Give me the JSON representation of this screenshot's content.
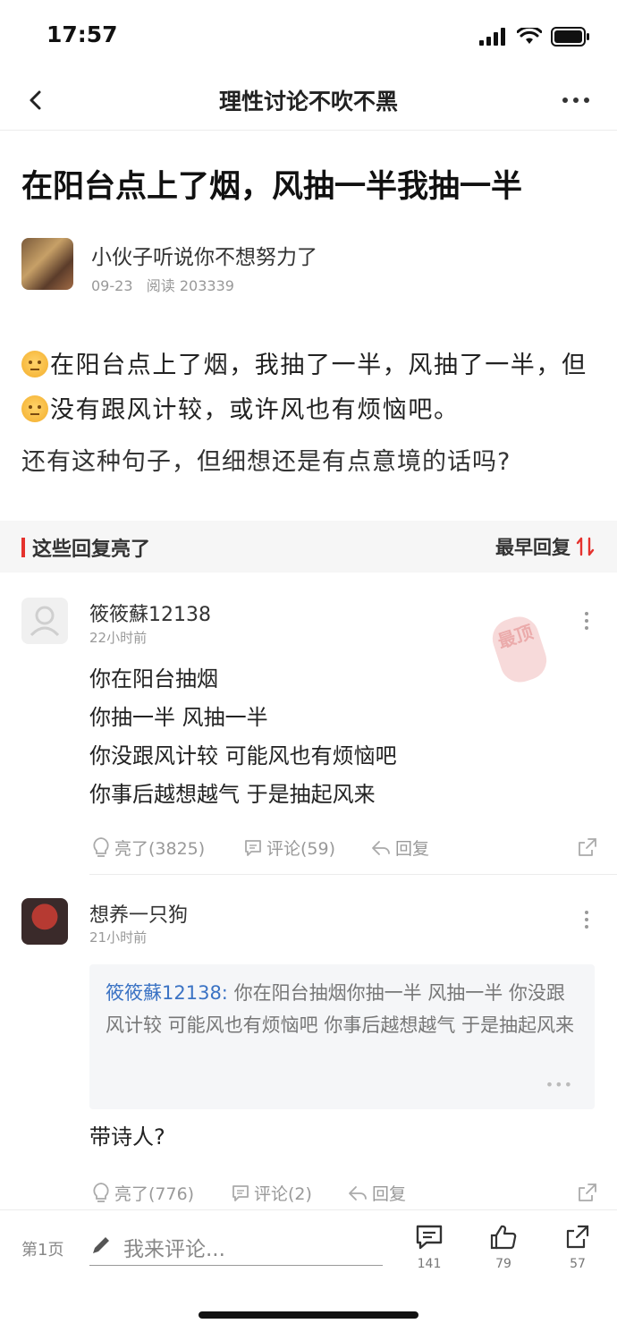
{
  "status": {
    "time": "17:57"
  },
  "nav": {
    "title": "理性讨论不吹不黑"
  },
  "post": {
    "title": "在阳台点上了烟，风抽一半我抽一半",
    "author": "小伙子听说你不想努力了",
    "date": "09-23",
    "read_label": "阅读 203339",
    "body_part1": "在阳台点上了烟，我抽了一半，风抽了一半，但",
    "body_part2": "没有跟风计较，或许风也有烦恼吧。",
    "body_line2": "还有这种句子，但细想还是有点意境的话吗?"
  },
  "section": {
    "title": "这些回复亮了",
    "sort_label": "最早回复"
  },
  "comments": [
    {
      "user": "筱筱蘇12138",
      "time": "22小时前",
      "lines": [
        "你在阳台抽烟",
        "你抽一半 风抽一半",
        "你没跟风计较 可能风也有烦恼吧",
        "你事后越想越气 于是抽起风来"
      ],
      "stamp": "最顶",
      "likes": "亮了(3825)",
      "comments": "评论(59)",
      "reply": "回复"
    },
    {
      "user": "想养一只狗",
      "time": "21小时前",
      "quote_user": "筱筱蘇12138:",
      "quote_text": " 你在阳台抽烟你抽一半 风抽一半 你没跟风计较 可能风也有烦恼吧 你事后越想越气 于是抽起风来",
      "quote_more": "•••",
      "text": "带诗人?",
      "likes": "亮了(776)",
      "comments": "评论(2)",
      "reply": "回复"
    }
  ],
  "bottom": {
    "page": "第1页",
    "placeholder": "我来评论...",
    "comment_count": "141",
    "like_count": "79",
    "share_count": "57"
  }
}
